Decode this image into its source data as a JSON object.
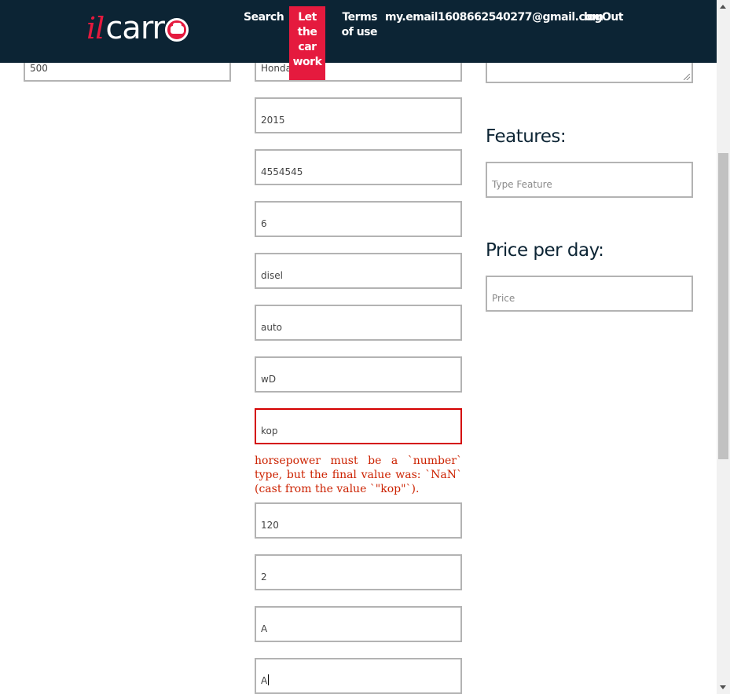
{
  "header": {
    "logo_text_il": "il",
    "logo_text_carr": "carr",
    "nav": {
      "search": "Search",
      "let_car_work": "Let the car work",
      "terms": "Terms of use",
      "email": "my.email1608662540277@gmail.com",
      "logout": "logOut"
    }
  },
  "left": {
    "field_value": "500"
  },
  "middle": {
    "fields": [
      "Honda",
      "2015",
      "4554545",
      "6",
      "disel",
      "auto",
      "wD",
      "kop",
      "120",
      "2",
      "A",
      "A"
    ],
    "error": "horsepower must be a `number` type, but the final value was: `NaN` (cast from the value `\"kop\"`)."
  },
  "right": {
    "features_title": "Features:",
    "features_placeholder": "Type Feature",
    "price_title": "Price per day:",
    "price_placeholder": "Price"
  },
  "colors": {
    "header_bg": "#0c2434",
    "accent": "#e51a3e",
    "error": "#d40000"
  }
}
